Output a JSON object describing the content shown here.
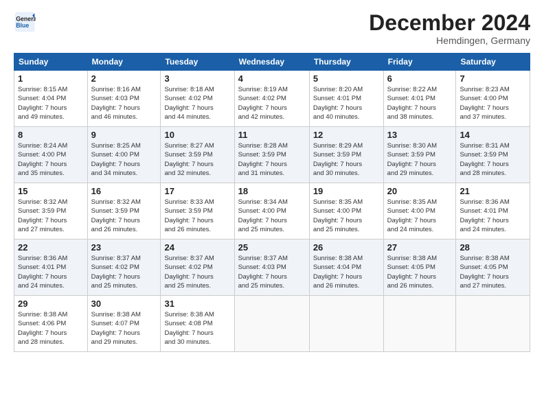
{
  "header": {
    "logo_line1": "General",
    "logo_line2": "Blue",
    "title": "December 2024",
    "subtitle": "Hemdingen, Germany"
  },
  "days_of_week": [
    "Sunday",
    "Monday",
    "Tuesday",
    "Wednesday",
    "Thursday",
    "Friday",
    "Saturday"
  ],
  "weeks": [
    [
      {
        "day": "1",
        "info": "Sunrise: 8:15 AM\nSunset: 4:04 PM\nDaylight: 7 hours\nand 49 minutes."
      },
      {
        "day": "2",
        "info": "Sunrise: 8:16 AM\nSunset: 4:03 PM\nDaylight: 7 hours\nand 46 minutes."
      },
      {
        "day": "3",
        "info": "Sunrise: 8:18 AM\nSunset: 4:02 PM\nDaylight: 7 hours\nand 44 minutes."
      },
      {
        "day": "4",
        "info": "Sunrise: 8:19 AM\nSunset: 4:02 PM\nDaylight: 7 hours\nand 42 minutes."
      },
      {
        "day": "5",
        "info": "Sunrise: 8:20 AM\nSunset: 4:01 PM\nDaylight: 7 hours\nand 40 minutes."
      },
      {
        "day": "6",
        "info": "Sunrise: 8:22 AM\nSunset: 4:01 PM\nDaylight: 7 hours\nand 38 minutes."
      },
      {
        "day": "7",
        "info": "Sunrise: 8:23 AM\nSunset: 4:00 PM\nDaylight: 7 hours\nand 37 minutes."
      }
    ],
    [
      {
        "day": "8",
        "info": "Sunrise: 8:24 AM\nSunset: 4:00 PM\nDaylight: 7 hours\nand 35 minutes."
      },
      {
        "day": "9",
        "info": "Sunrise: 8:25 AM\nSunset: 4:00 PM\nDaylight: 7 hours\nand 34 minutes."
      },
      {
        "day": "10",
        "info": "Sunrise: 8:27 AM\nSunset: 3:59 PM\nDaylight: 7 hours\nand 32 minutes."
      },
      {
        "day": "11",
        "info": "Sunrise: 8:28 AM\nSunset: 3:59 PM\nDaylight: 7 hours\nand 31 minutes."
      },
      {
        "day": "12",
        "info": "Sunrise: 8:29 AM\nSunset: 3:59 PM\nDaylight: 7 hours\nand 30 minutes."
      },
      {
        "day": "13",
        "info": "Sunrise: 8:30 AM\nSunset: 3:59 PM\nDaylight: 7 hours\nand 29 minutes."
      },
      {
        "day": "14",
        "info": "Sunrise: 8:31 AM\nSunset: 3:59 PM\nDaylight: 7 hours\nand 28 minutes."
      }
    ],
    [
      {
        "day": "15",
        "info": "Sunrise: 8:32 AM\nSunset: 3:59 PM\nDaylight: 7 hours\nand 27 minutes."
      },
      {
        "day": "16",
        "info": "Sunrise: 8:32 AM\nSunset: 3:59 PM\nDaylight: 7 hours\nand 26 minutes."
      },
      {
        "day": "17",
        "info": "Sunrise: 8:33 AM\nSunset: 3:59 PM\nDaylight: 7 hours\nand 26 minutes."
      },
      {
        "day": "18",
        "info": "Sunrise: 8:34 AM\nSunset: 4:00 PM\nDaylight: 7 hours\nand 25 minutes."
      },
      {
        "day": "19",
        "info": "Sunrise: 8:35 AM\nSunset: 4:00 PM\nDaylight: 7 hours\nand 25 minutes."
      },
      {
        "day": "20",
        "info": "Sunrise: 8:35 AM\nSunset: 4:00 PM\nDaylight: 7 hours\nand 24 minutes."
      },
      {
        "day": "21",
        "info": "Sunrise: 8:36 AM\nSunset: 4:01 PM\nDaylight: 7 hours\nand 24 minutes."
      }
    ],
    [
      {
        "day": "22",
        "info": "Sunrise: 8:36 AM\nSunset: 4:01 PM\nDaylight: 7 hours\nand 24 minutes."
      },
      {
        "day": "23",
        "info": "Sunrise: 8:37 AM\nSunset: 4:02 PM\nDaylight: 7 hours\nand 25 minutes."
      },
      {
        "day": "24",
        "info": "Sunrise: 8:37 AM\nSunset: 4:02 PM\nDaylight: 7 hours\nand 25 minutes."
      },
      {
        "day": "25",
        "info": "Sunrise: 8:37 AM\nSunset: 4:03 PM\nDaylight: 7 hours\nand 25 minutes."
      },
      {
        "day": "26",
        "info": "Sunrise: 8:38 AM\nSunset: 4:04 PM\nDaylight: 7 hours\nand 26 minutes."
      },
      {
        "day": "27",
        "info": "Sunrise: 8:38 AM\nSunset: 4:05 PM\nDaylight: 7 hours\nand 26 minutes."
      },
      {
        "day": "28",
        "info": "Sunrise: 8:38 AM\nSunset: 4:05 PM\nDaylight: 7 hours\nand 27 minutes."
      }
    ],
    [
      {
        "day": "29",
        "info": "Sunrise: 8:38 AM\nSunset: 4:06 PM\nDaylight: 7 hours\nand 28 minutes."
      },
      {
        "day": "30",
        "info": "Sunrise: 8:38 AM\nSunset: 4:07 PM\nDaylight: 7 hours\nand 29 minutes."
      },
      {
        "day": "31",
        "info": "Sunrise: 8:38 AM\nSunset: 4:08 PM\nDaylight: 7 hours\nand 30 minutes."
      },
      {
        "day": "",
        "info": ""
      },
      {
        "day": "",
        "info": ""
      },
      {
        "day": "",
        "info": ""
      },
      {
        "day": "",
        "info": ""
      }
    ]
  ]
}
